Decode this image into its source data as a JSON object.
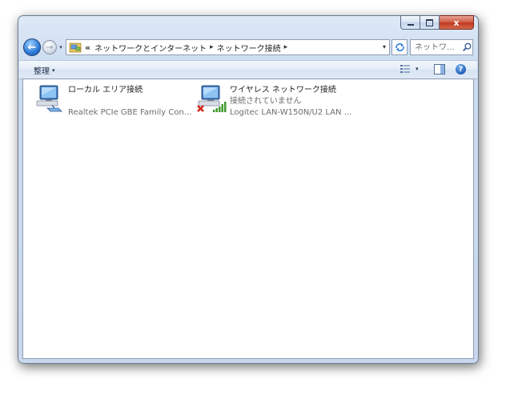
{
  "window": {
    "caption_close": "x"
  },
  "nav": {
    "back_glyph": "←",
    "forward_glyph": "→",
    "history_glyph": "▾",
    "overflow": "«",
    "crumbs": [
      "ネットワークとインターネット",
      "ネットワーク接続"
    ],
    "separator": "▸",
    "dropdown": "▾"
  },
  "search": {
    "placeholder": "ネットワ..."
  },
  "toolbar": {
    "organize_label": "整理",
    "organize_arrow": "▾",
    "view_arrow": "▾",
    "help_glyph": "?"
  },
  "connections": [
    {
      "name": "ローカル エリア接続",
      "status": "",
      "device": "Realtek PCIe GBE Family Con...",
      "icon": "wired-network-icon"
    },
    {
      "name": "ワイヤレス ネットワーク接続",
      "status": "接続されていません",
      "device": "Logitec LAN-W150N/U2 LAN ...",
      "icon": "wireless-network-icon"
    }
  ],
  "colors": {
    "accent": "#2d7ad8",
    "error_red": "#d42a1e",
    "signal_green": "#3e9a2c"
  }
}
